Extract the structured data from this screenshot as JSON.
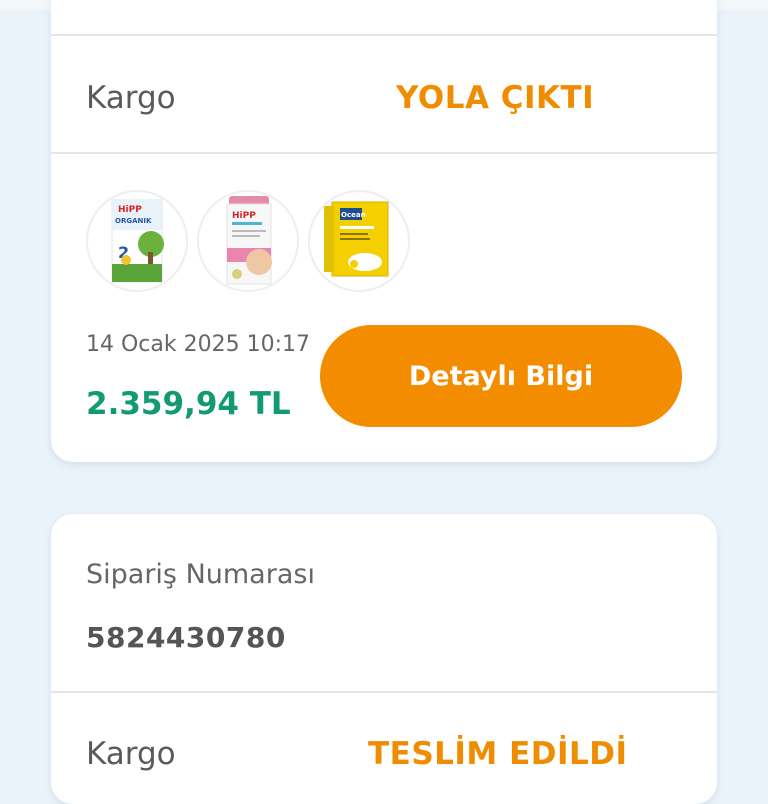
{
  "order1": {
    "cargo_label": "Kargo",
    "cargo_status": "YOLA ÇIKTI",
    "products": [
      {
        "name": "HiPP Organik 2",
        "icon": "hipp-organik-formula-box"
      },
      {
        "name": "HiPP Bitki Çayı",
        "icon": "hipp-tea-canister"
      },
      {
        "name": "Ocean Vitamin D",
        "icon": "ocean-vitamin-d-box"
      }
    ],
    "date": "14 Ocak 2025 10:17",
    "price": "2.359,94 TL",
    "details_button": "Detaylı Bilgi"
  },
  "order2": {
    "order_number_label": "Sipariş Numarası",
    "order_number": "5824430780",
    "cargo_label": "Kargo",
    "cargo_status": "TESLİM EDİLDİ"
  },
  "colors": {
    "background": "#eaf3fa",
    "accent": "#f48c00",
    "status": "#f08c00",
    "price": "#129a72"
  }
}
